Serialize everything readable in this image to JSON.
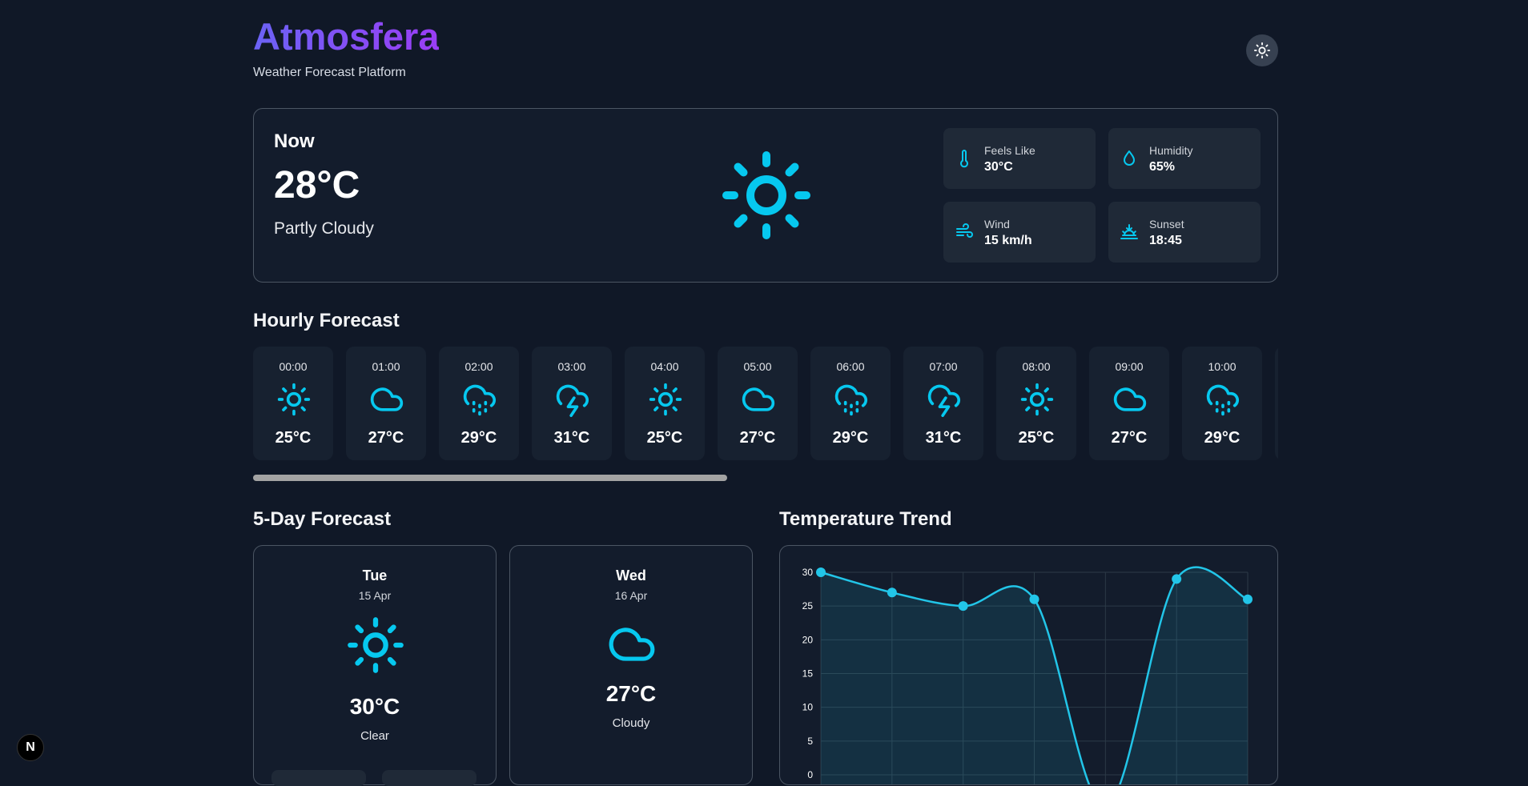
{
  "header": {
    "brand": "Atmosfera",
    "subtitle": "Weather Forecast Platform",
    "theme_icon": "sun-icon"
  },
  "current": {
    "label": "Now",
    "temperature": "28°C",
    "condition": "Partly Cloudy",
    "icon": "sun-icon",
    "stats": [
      {
        "label": "Feels Like",
        "value": "30°C",
        "icon": "thermometer-icon"
      },
      {
        "label": "Humidity",
        "value": "65%",
        "icon": "droplet-icon"
      },
      {
        "label": "Wind",
        "value": "15 km/h",
        "icon": "wind-icon"
      },
      {
        "label": "Sunset",
        "value": "18:45",
        "icon": "sunset-icon"
      }
    ]
  },
  "hourly": {
    "title": "Hourly Forecast",
    "items": [
      {
        "time": "00:00",
        "icon": "sun",
        "temp": "25°C"
      },
      {
        "time": "01:00",
        "icon": "cloud",
        "temp": "27°C"
      },
      {
        "time": "02:00",
        "icon": "rain",
        "temp": "29°C"
      },
      {
        "time": "03:00",
        "icon": "storm",
        "temp": "31°C"
      },
      {
        "time": "04:00",
        "icon": "sun",
        "temp": "25°C"
      },
      {
        "time": "05:00",
        "icon": "cloud",
        "temp": "27°C"
      },
      {
        "time": "06:00",
        "icon": "rain",
        "temp": "29°C"
      },
      {
        "time": "07:00",
        "icon": "storm",
        "temp": "31°C"
      },
      {
        "time": "08:00",
        "icon": "sun",
        "temp": "25°C"
      },
      {
        "time": "09:00",
        "icon": "cloud",
        "temp": "27°C"
      },
      {
        "time": "10:00",
        "icon": "rain",
        "temp": "29°C"
      }
    ]
  },
  "daily": {
    "title": "5-Day Forecast",
    "items": [
      {
        "day": "Tue",
        "date": "15 Apr",
        "icon": "sun",
        "temp": "30°C",
        "condition": "Clear"
      },
      {
        "day": "Wed",
        "date": "16 Apr",
        "icon": "cloud",
        "temp": "27°C",
        "condition": "Cloudy"
      }
    ]
  },
  "trend": {
    "title": "Temperature Trend"
  },
  "chart_data": {
    "type": "line",
    "title": "",
    "x": [
      0,
      1,
      2,
      3,
      4,
      5,
      6
    ],
    "values": [
      30,
      27,
      25,
      26,
      null,
      29,
      26
    ],
    "y_ticks": [
      "30",
      "25",
      "20",
      "15",
      "10",
      "5",
      "0"
    ],
    "ylim": [
      0,
      30
    ],
    "grid": true,
    "color": "#22c5e8"
  },
  "colors": {
    "accent": "#06c8ef",
    "background": "#101827",
    "card": "#131c2c"
  },
  "dev_badge": "N"
}
